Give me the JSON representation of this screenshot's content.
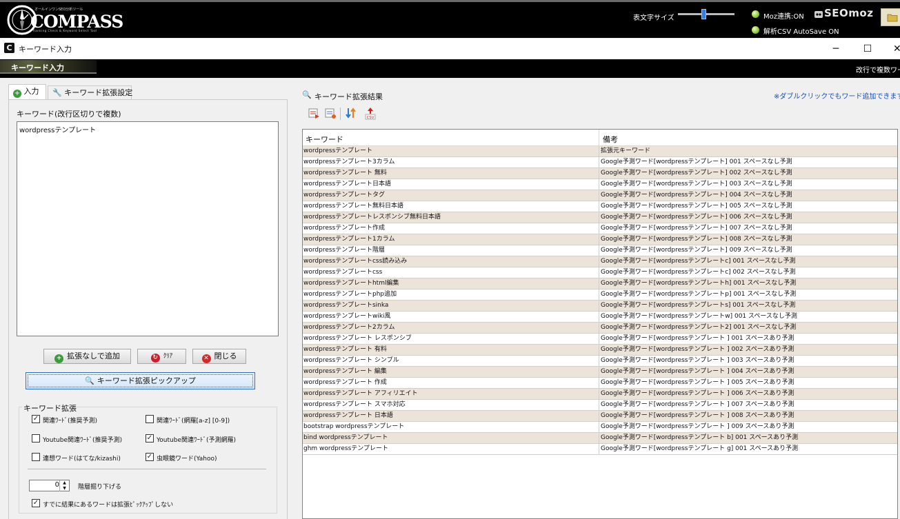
{
  "topbar": {
    "logo": {
      "main": "COMPASS",
      "sub_top": "オールインワンSEO分析ツール",
      "sub_bottom": "Ranking Check & Keyword Select Tool"
    },
    "font_size_label": "表文字サイズ",
    "font_size_level": 0.45,
    "status": [
      {
        "label": "Moz連携:ON"
      },
      {
        "label": "解析CSV AutoSave ON"
      }
    ],
    "seomoz_logo": "SEOmoz"
  },
  "window": {
    "icon": "C",
    "title": "キーワード入力",
    "controls": {
      "minimize": "─",
      "maximize": "☐",
      "close": "✕"
    }
  },
  "banner": {
    "title": "キーワード入力",
    "hint": "改行で複数ワー"
  },
  "tabs": [
    {
      "label": "入力",
      "icon": "plus-circle-icon",
      "active": true
    },
    {
      "label": "キーワード拡張設定",
      "icon": "wrench-icon",
      "active": false
    }
  ],
  "left": {
    "keyword_label": "キーワード(改行区切りで複数)",
    "keyword_value": "wordpressテンプレート",
    "buttons": {
      "add": "拡張なしで追加",
      "clear": "ｸﾘｱ",
      "close": "閉じる",
      "pickup": "キーワード拡張ピックアップ"
    },
    "group_label": "キーワード拡張",
    "options": [
      {
        "label": "関連ﾜｰﾄﾞ(推奨予測)",
        "checked": true
      },
      {
        "label": "関連ﾜｰﾄﾞ(網羅[a-z] [0-9])",
        "checked": false
      },
      {
        "label": "Youtube関連ﾜｰﾄﾞ(推奨予測)",
        "checked": false
      },
      {
        "label": "Youtube関連ﾜｰﾄﾞ(予測網羅)",
        "checked": true
      },
      {
        "label": "連想ワード(はてな/kizashi)",
        "checked": false
      },
      {
        "label": "虫眼鏡ワード(Yahoo)",
        "checked": true
      }
    ],
    "depth_value": "0",
    "depth_label": "階層掘り下げる",
    "skip_option": {
      "label": "すでに結果にあるワードは拡張ﾋﾟｯｸｱｯﾌﾟしない",
      "checked": true
    }
  },
  "results": {
    "title": "キーワード拡張結果",
    "note": "※ダブルクリックでもワード追加できます",
    "columns": [
      "キーワード",
      "備考"
    ],
    "rows": [
      [
        "wordpressテンプレート",
        "拡張元キーワード"
      ],
      [
        "wordpressテンプレート3カラム",
        "Google予測ワード[wordpressテンプレート] 001 スペースなし予測"
      ],
      [
        "wordpressテンプレート 無料",
        "Google予測ワード[wordpressテンプレート] 002 スペースなし予測"
      ],
      [
        "wordpressテンプレート日本語",
        "Google予測ワード[wordpressテンプレート] 003 スペースなし予測"
      ],
      [
        "wordpressテンプレートタグ",
        "Google予測ワード[wordpressテンプレート] 004 スペースなし予測"
      ],
      [
        "wordpressテンプレート無料日本語",
        "Google予測ワード[wordpressテンプレート] 005 スペースなし予測"
      ],
      [
        "wordpressテンプレートレスポンシブ無料日本語",
        "Google予測ワード[wordpressテンプレート] 006 スペースなし予測"
      ],
      [
        "wordpressテンプレート作成",
        "Google予測ワード[wordpressテンプレート] 007 スペースなし予測"
      ],
      [
        "wordpressテンプレート1カラム",
        "Google予測ワード[wordpressテンプレート] 008 スペースなし予測"
      ],
      [
        "wordpressテンプレート階層",
        "Google予測ワード[wordpressテンプレート] 009 スペースなし予測"
      ],
      [
        "wordpressテンプレートcss読み込み",
        "Google予測ワード[wordpressテンプレートc] 001 スペースなし予測"
      ],
      [
        "wordpressテンプレートcss",
        "Google予測ワード[wordpressテンプレートc] 002 スペースなし予測"
      ],
      [
        "wordpressテンプレートhtml編集",
        "Google予測ワード[wordpressテンプレートh] 001 スペースなし予測"
      ],
      [
        "wordpressテンプレートphp追加",
        "Google予測ワード[wordpressテンプレートp] 001 スペースなし予測"
      ],
      [
        "wordpressテンプレートsinka",
        "Google予測ワード[wordpressテンプレートs] 001 スペースなし予測"
      ],
      [
        "wordpressテンプレートwiki風",
        "Google予測ワード[wordpressテンプレートw] 001 スペースなし予測"
      ],
      [
        "wordpressテンプレート2カラム",
        "Google予測ワード[wordpressテンプレート2] 001 スペースなし予測"
      ],
      [
        "wordpressテンプレート レスポンシブ",
        "Google予測ワード[wordpressテンプレート ] 001 スペースあり予測"
      ],
      [
        "wordpressテンプレート 有料",
        "Google予測ワード[wordpressテンプレート ] 002 スペースあり予測"
      ],
      [
        "wordpressテンプレート シンプル",
        "Google予測ワード[wordpressテンプレート ] 003 スペースあり予測"
      ],
      [
        "wordpressテンプレート 編集",
        "Google予測ワード[wordpressテンプレート ] 004 スペースあり予測"
      ],
      [
        "wordpressテンプレート 作成",
        "Google予測ワード[wordpressテンプレート ] 005 スペースあり予測"
      ],
      [
        "wordpressテンプレート アフィリエイト",
        "Google予測ワード[wordpressテンプレート ] 006 スペースあり予測"
      ],
      [
        "wordpressテンプレート スマホ対応",
        "Google予測ワード[wordpressテンプレート ] 007 スペースあり予測"
      ],
      [
        "wordpressテンプレート 日本語",
        "Google予測ワード[wordpressテンプレート ] 008 スペースあり予測"
      ],
      [
        "bootstrap wordpressテンプレート",
        "Google予測ワード[wordpressテンプレート ] 009 スペースあり予測"
      ],
      [
        "bind wordpressテンプレート",
        "Google予測ワード[wordpressテンプレート b] 001 スペースあり予測"
      ],
      [
        "ghm wordpressテンプレート",
        "Google予測ワード[wordpressテンプレート g] 001 スペースあり予測"
      ]
    ]
  },
  "colors": {
    "row_alt": "#ede4d9",
    "accent_blue": "#2f7fe0",
    "note_blue": "#1d4fb0",
    "status_green": "#8cc83a"
  }
}
